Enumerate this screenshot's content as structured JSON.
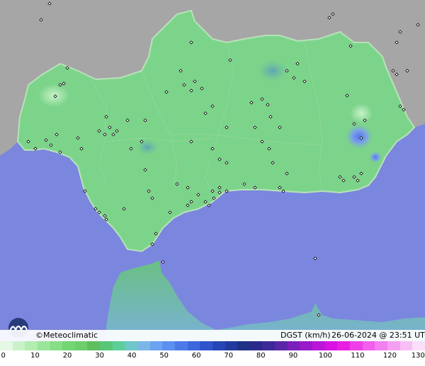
{
  "brand": {
    "copyright": "©",
    "name": "Meteoclimatic"
  },
  "parameter_label": "DGST (km/h)",
  "timestamp": "26-06-2024 @ 23:51 UTC",
  "icons": {
    "logo": "meteoclimatic-logo",
    "station": "station-marker"
  },
  "colors": {
    "sea": "#7b86de",
    "land_outside": "#a6a6a6",
    "region": "#7cd48b",
    "coast": "#b7e2b9",
    "station": "#ffffff"
  },
  "legend": {
    "ticks": [
      "0",
      "10",
      "20",
      "30",
      "40",
      "50",
      "60",
      "70",
      "80",
      "90",
      "100",
      "110",
      "120",
      "130"
    ],
    "colors": [
      "#e5f7e5",
      "#c9f2c9",
      "#b2edb2",
      "#9ae59a",
      "#86de86",
      "#72d672",
      "#6ccf6c",
      "#5fbf5f",
      "#58c678",
      "#5ccf98",
      "#6ec7c8",
      "#7ab7e6",
      "#6ca3f0",
      "#5c8ff0",
      "#4c7be8",
      "#3d67dd",
      "#2f55cc",
      "#2746b5",
      "#213a9e",
      "#1e3187",
      "#2a2a8a",
      "#3d2a98",
      "#5a26a8",
      "#7a1fb9",
      "#9a19c9",
      "#bb15d8",
      "#d811e4",
      "#e81fe3",
      "#ee3fe8",
      "#f15fec",
      "#f37ff0",
      "#f59ff3",
      "#f7bff6",
      "#f9dff9"
    ]
  },
  "stations": [
    [
      58,
      28
    ],
    [
      70,
      5
    ],
    [
      95,
      96
    ],
    [
      85,
      120
    ],
    [
      90,
      118
    ],
    [
      78,
      136
    ],
    [
      40,
      200
    ],
    [
      50,
      210
    ],
    [
      65,
      198
    ],
    [
      72,
      205
    ],
    [
      80,
      190
    ],
    [
      110,
      195
    ],
    [
      85,
      215
    ],
    [
      115,
      210
    ],
    [
      150,
      165
    ],
    [
      155,
      180
    ],
    [
      160,
      190
    ],
    [
      148,
      190
    ],
    [
      165,
      185
    ],
    [
      140,
      185
    ],
    [
      180,
      170
    ],
    [
      185,
      210
    ],
    [
      200,
      200
    ],
    [
      205,
      240
    ],
    [
      210,
      270
    ],
    [
      215,
      280
    ],
    [
      220,
      330
    ],
    [
      240,
      300
    ],
    [
      250,
      260
    ],
    [
      265,
      265
    ],
    [
      265,
      290
    ],
    [
      270,
      285
    ],
    [
      280,
      275
    ],
    [
      290,
      285
    ],
    [
      300,
      270
    ],
    [
      310,
      265
    ],
    [
      295,
      290
    ],
    [
      302,
      280
    ],
    [
      310,
      272
    ],
    [
      320,
      270
    ],
    [
      270,
      60
    ],
    [
      255,
      100
    ],
    [
      260,
      120
    ],
    [
      270,
      128
    ],
    [
      275,
      115
    ],
    [
      285,
      125
    ],
    [
      300,
      150
    ],
    [
      290,
      160
    ],
    [
      270,
      200
    ],
    [
      300,
      210
    ],
    [
      310,
      225
    ],
    [
      320,
      230
    ],
    [
      345,
      260
    ],
    [
      360,
      265
    ],
    [
      395,
      265
    ],
    [
      400,
      270
    ],
    [
      405,
      245
    ],
    [
      385,
      230
    ],
    [
      380,
      210
    ],
    [
      370,
      200
    ],
    [
      360,
      180
    ],
    [
      355,
      145
    ],
    [
      370,
      140
    ],
    [
      378,
      148
    ],
    [
      382,
      165
    ],
    [
      395,
      180
    ],
    [
      405,
      100
    ],
    [
      415,
      110
    ],
    [
      420,
      90
    ],
    [
      430,
      115
    ],
    [
      465,
      25
    ],
    [
      470,
      20
    ],
    [
      495,
      65
    ],
    [
      490,
      135
    ],
    [
      500,
      175
    ],
    [
      510,
      195
    ],
    [
      515,
      170
    ],
    [
      500,
      250
    ],
    [
      505,
      255
    ],
    [
      510,
      245
    ],
    [
      485,
      255
    ],
    [
      480,
      250
    ],
    [
      555,
      100
    ],
    [
      560,
      105
    ],
    [
      565,
      150
    ],
    [
      570,
      155
    ],
    [
      575,
      100
    ],
    [
      560,
      60
    ],
    [
      565,
      45
    ],
    [
      590,
      35
    ],
    [
      120,
      270
    ],
    [
      135,
      295
    ],
    [
      140,
      300
    ],
    [
      148,
      305
    ],
    [
      150,
      310
    ],
    [
      175,
      295
    ],
    [
      230,
      370
    ],
    [
      215,
      345
    ],
    [
      445,
      365
    ],
    [
      450,
      445
    ],
    [
      205,
      170
    ],
    [
      235,
      130
    ],
    [
      325,
      85
    ],
    [
      320,
      180
    ]
  ]
}
